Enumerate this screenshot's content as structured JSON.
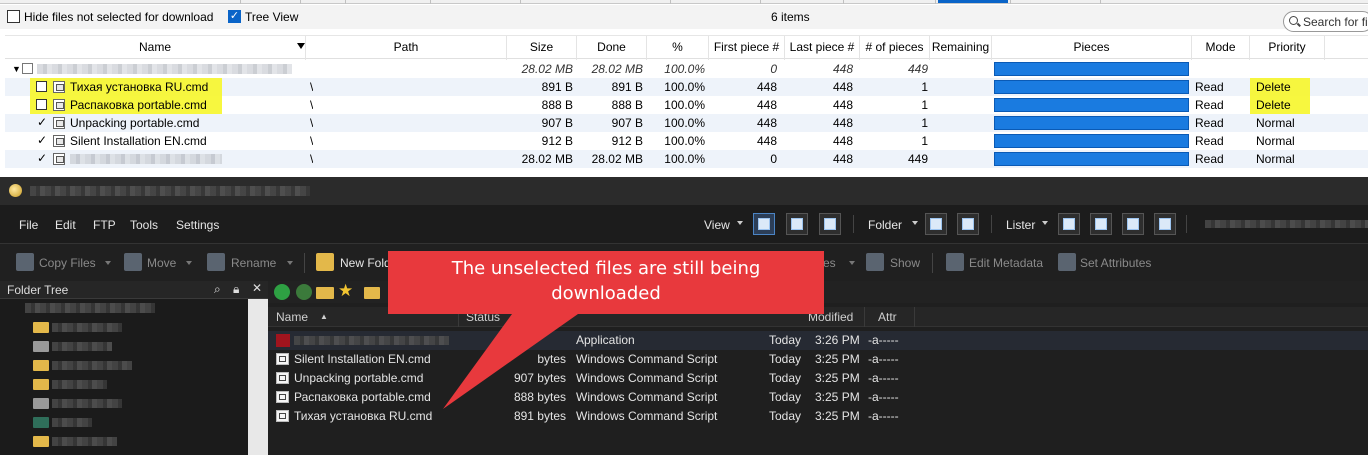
{
  "torrent": {
    "options": {
      "hide_unselected_label": "Hide files not selected for download",
      "hide_unselected_checked": false,
      "tree_view_label": "Tree View",
      "tree_view_checked": true,
      "items_count": "6 items",
      "search_placeholder": "Search for fil"
    },
    "columns": [
      "Name",
      "Path",
      "Size",
      "Done",
      "%",
      "First piece #",
      "Last piece #",
      "# of pieces",
      "Remaining",
      "Pieces",
      "Mode",
      "Priority"
    ],
    "root_row": {
      "size": "28.02 MB",
      "done": "28.02 MB",
      "pct": "100.0%",
      "first": "0",
      "last": "448",
      "pieces": "449",
      "progress": 1.0
    },
    "files": [
      {
        "name": "Тихая установка RU.cmd",
        "checked": false,
        "path": "\\",
        "size": "891 B",
        "done": "891 B",
        "pct": "100.0%",
        "first": "448",
        "last": "448",
        "pieces": "1",
        "progress": 1.0,
        "mode": "Read",
        "priority": "Delete",
        "highlight": true
      },
      {
        "name": "Распаковка portable.cmd",
        "checked": false,
        "path": "\\",
        "size": "888 B",
        "done": "888 B",
        "pct": "100.0%",
        "first": "448",
        "last": "448",
        "pieces": "1",
        "progress": 1.0,
        "mode": "Read",
        "priority": "Delete",
        "highlight": true
      },
      {
        "name": "Unpacking portable.cmd",
        "checked": true,
        "path": "\\",
        "size": "907 B",
        "done": "907 B",
        "pct": "100.0%",
        "first": "448",
        "last": "448",
        "pieces": "1",
        "progress": 1.0,
        "mode": "Read",
        "priority": "Normal",
        "highlight": false
      },
      {
        "name": "Silent Installation EN.cmd",
        "checked": true,
        "path": "\\",
        "size": "912 B",
        "done": "912 B",
        "pct": "100.0%",
        "first": "448",
        "last": "448",
        "pieces": "1",
        "progress": 1.0,
        "mode": "Read",
        "priority": "Normal",
        "highlight": false
      },
      {
        "name": "",
        "checked": true,
        "path": "\\",
        "size": "28.02 MB",
        "done": "28.02 MB",
        "pct": "100.0%",
        "first": "0",
        "last": "448",
        "pieces": "449",
        "progress": 1.0,
        "mode": "Read",
        "priority": "Normal",
        "highlight": false
      }
    ],
    "highlight_color": "#f6f62a",
    "progress_color": "#1a7be0"
  },
  "fm": {
    "menu": [
      "File",
      "Edit",
      "FTP",
      "Tools",
      "Settings"
    ],
    "view_label": "View",
    "folder_label": "Folder",
    "lister_label": "Lister",
    "toolbar": {
      "copy_files": "Copy Files",
      "move": "Move",
      "rename": "Rename",
      "new_folder": "New Fold",
      "es": "es",
      "show": "Show",
      "edit_metadata": "Edit Metadata",
      "set_attributes": "Set Attributes"
    },
    "folder_tree_label": "Folder Tree",
    "file_columns": {
      "name": "Name",
      "status": "Status",
      "modified": "Modified",
      "attr": "Attr"
    },
    "files": [
      {
        "name": "",
        "size": "",
        "type": "Application",
        "day": "Today",
        "time": "3:26 PM",
        "attr": "-a-----"
      },
      {
        "name": "Silent Installation EN.cmd",
        "size": "bytes",
        "type": "Windows Command Script",
        "day": "Today",
        "time": "3:25 PM",
        "attr": "-a-----"
      },
      {
        "name": "Unpacking portable.cmd",
        "size": "907 bytes",
        "type": "Windows Command Script",
        "day": "Today",
        "time": "3:25 PM",
        "attr": "-a-----"
      },
      {
        "name": "Распаковка portable.cmd",
        "size": "888 bytes",
        "type": "Windows Command Script",
        "day": "Today",
        "time": "3:25 PM",
        "attr": "-a-----"
      },
      {
        "name": "Тихая установка RU.cmd",
        "size": "891 bytes",
        "type": "Windows Command Script",
        "day": "Today",
        "time": "3:25 PM",
        "attr": "-a-----"
      }
    ]
  },
  "callout": {
    "line1": "The unselected files are still being",
    "line2": "downloaded",
    "color": "#e8393d"
  }
}
